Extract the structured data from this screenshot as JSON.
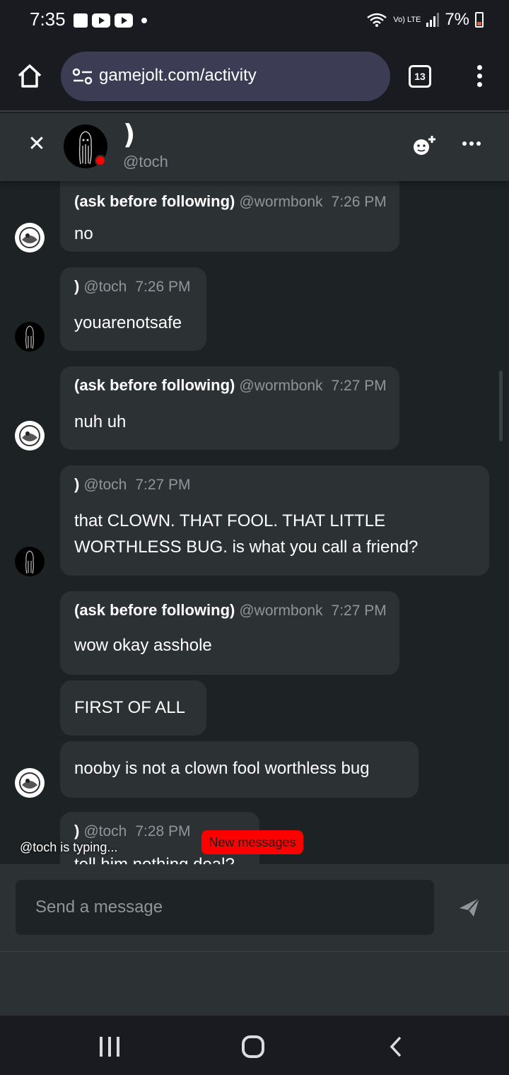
{
  "status_bar": {
    "time": "7:35",
    "network_label": "Vo) LTE",
    "battery": "7%",
    "battery_color": "#e85a3b"
  },
  "browser": {
    "url": "gamejolt.com/activity",
    "tab_count": "13"
  },
  "chat": {
    "name": ")",
    "username": "@toch",
    "status_color": "#ff0000",
    "add_friend_icon": "add-friend-icon",
    "more_icon": "more-horizontal-icon"
  },
  "messages": [
    {
      "author": "(ask before following)",
      "username": "@wormbonk",
      "time": "7:26 PM",
      "text": "no"
    },
    {
      "author": ")",
      "username": "@toch",
      "time": "7:26 PM",
      "text": "youarenotsafe"
    },
    {
      "author": "(ask before following)",
      "username": "@wormbonk",
      "time": "7:27 PM",
      "text": "nuh uh"
    },
    {
      "author": ")",
      "username": "@toch",
      "time": "7:27 PM",
      "text_line1": "that CLOWN. THAT FOOL. THAT LITTLE",
      "text_line2": "WORTHLESS BUG. is what you call a friend?"
    },
    {
      "author": "(ask before following)",
      "username": "@wormbonk",
      "time": "7:27 PM",
      "text": "wow okay asshole"
    },
    {
      "text": "FIRST OF ALL"
    },
    {
      "text": "nooby is not a clown fool worthless bug"
    },
    {
      "author": ")",
      "username": "@toch",
      "time": "7:28 PM",
      "text": "tell him nothing deal?"
    }
  ],
  "typing_indicator": "@toch is typing...",
  "new_messages_label": "New messages",
  "new_messages_color": "#ff0000",
  "composer": {
    "placeholder": "Send a message"
  }
}
